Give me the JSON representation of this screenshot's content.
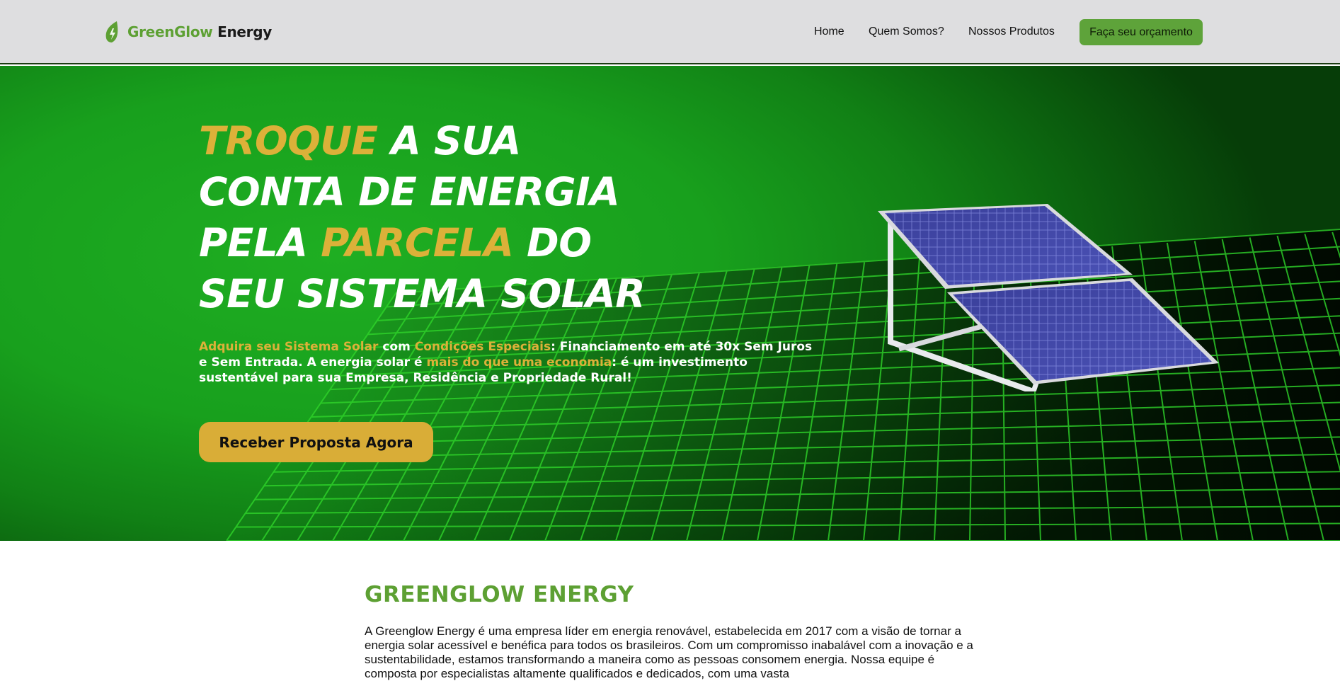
{
  "header": {
    "logo": {
      "green": "GreenGlow",
      "dark": "Energy",
      "icon": "leaf-bolt-icon"
    },
    "nav": [
      {
        "label": "Home"
      },
      {
        "label": "Quem Somos?"
      },
      {
        "label": "Nossos Produtos"
      }
    ],
    "cta_label": "Faça seu orçamento"
  },
  "hero": {
    "title": {
      "w1": "TROQUE",
      "w2": " A SUA",
      "line2": "CONTA DE ENERGIA",
      "w3": "PELA ",
      "w4": "PARCELA",
      "w5": " DO",
      "line4": "SEU SISTEMA SOLAR"
    },
    "lead": {
      "p1": "Adquira seu Sistema Solar",
      "p2": " com ",
      "p3": "Condições Especiais",
      "p4": ": Financiamento em até 30x Sem Juros e Sem Entrada. A energia solar é ",
      "p5": "mais do que uma economia",
      "p6": ": é um investimento sustentável para sua Empresa, Residência e Propriedade Rural!"
    },
    "button_label": "Receber Proposta Agora"
  },
  "about": {
    "title": "GREENGLOW ENERGY",
    "text": "A Greenglow Energy é uma empresa líder em energia renovável, estabelecida em 2017 com a visão de tornar a energia solar acessível e benéfica para todos os brasileiros. Com um compromisso inabalável com a inovação e a sustentabilidade, estamos transformando a maneira como as pessoas consomem energia. Nossa equipe é composta por especialistas altamente qualificados e dedicados, com uma vasta"
  },
  "colors": {
    "brand_green": "#5da033",
    "accent_yellow": "#dcb139",
    "hero_green": "#18a01d",
    "header_bg": "#dedee0"
  }
}
